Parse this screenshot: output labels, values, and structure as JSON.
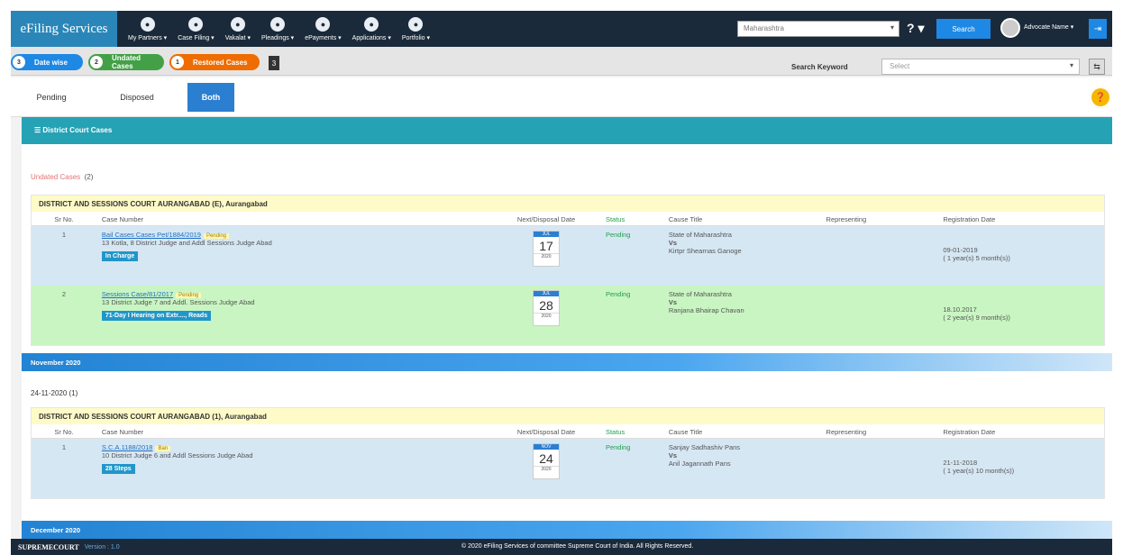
{
  "nav": {
    "brand": "eFiling Services",
    "items": [
      {
        "label": "My Partners ▾",
        "icon": "people-icon"
      },
      {
        "label": "Case Filing ▾",
        "icon": "edit-icon"
      },
      {
        "label": "Vakalat ▾",
        "icon": "document-icon"
      },
      {
        "label": "Pleadings ▾",
        "icon": "pleadings-icon"
      },
      {
        "label": "ePayments ▾",
        "icon": "rupee-icon"
      },
      {
        "label": "Applications ▾",
        "icon": "applications-icon"
      },
      {
        "label": "Portfolio ▾",
        "icon": "portfolio-icon"
      }
    ],
    "state_select": "Maharashtra",
    "help_label": "? ▾",
    "search_label": "Search",
    "user_name": "Advocate Name ▾"
  },
  "pills": [
    {
      "label": "Date wise",
      "count": "3",
      "color": "#1e88e5"
    },
    {
      "label": "Undated Cases",
      "count": "2",
      "color": "#43a047"
    },
    {
      "label": "Restored Cases",
      "count": "1",
      "color": "#ef6c00"
    }
  ],
  "square_label": "3",
  "search_keyword": {
    "label": "Search Keyword",
    "placeholder": "Select"
  },
  "tabs": [
    {
      "label": "Pending",
      "active": false
    },
    {
      "label": "Disposed",
      "active": false
    },
    {
      "label": "Both",
      "active": true
    }
  ],
  "section_title": "☰ District Court Cases",
  "undated": {
    "label": "Undated Cases",
    "count": "(2)"
  },
  "columns": [
    "Sr No.",
    "Case Number",
    "Next/Disposal Date",
    "Status",
    "Cause Title",
    "Representing",
    "Registration Date"
  ],
  "court1": {
    "name": "DISTRICT AND SESSIONS COURT AURANGABAD (E), Aurangabad",
    "rows": [
      {
        "sr": "1",
        "case": "Bail Cases Cases Pet/1884/2019",
        "tag": "Pending",
        "court_desc": "13 Kotla, 8 District Judge and Addl Sessions Judge Abad",
        "badge": "In Charge",
        "cal_month": "JUL",
        "cal_day": "17",
        "cal_year": "2020",
        "status": "Pending",
        "title1": "State of Maharashtra",
        "vs": "Vs",
        "title2": "Kirtpr Shearnas Ganoge",
        "representing": "",
        "reg_date": "09-01-2019",
        "reg_duration": "( 1 year(s) 5 month(s))"
      },
      {
        "sr": "2",
        "case": "Sessions Case/81/2017",
        "tag": "Pending",
        "court_desc": "13 District Judge 7 and Addl. Sessions Judge Abad",
        "badge": "71-Day I Hearing on Extr...., Reads",
        "cal_month": "JUL",
        "cal_day": "28",
        "cal_year": "2020",
        "status": "Pending",
        "title1": "State of Maharashtra",
        "vs": "Vs",
        "title2": "Ranjana Bhairap Chavan",
        "representing": "",
        "reg_date": "18.10.2017",
        "reg_duration": "( 2 year(s) 9 month(s))"
      }
    ]
  },
  "month1": "November 2020",
  "date_group": "24-11-2020 (1)",
  "court2": {
    "name": "DISTRICT AND SESSIONS COURT AURANGABAD (1), Aurangabad",
    "rows": [
      {
        "sr": "1",
        "case": "S.C.A.1188/2018",
        "tag": "Ban",
        "court_desc": "10 District Judge 6 and Addl Sessions Judge Abad",
        "badge": "28 Steps",
        "cal_month": "NOV",
        "cal_day": "24",
        "cal_year": "2020",
        "status": "Pending",
        "title1": "Sanjay Sadhashiv Pans",
        "vs": "Vs",
        "title2": "Anil Jagannath Pans",
        "representing": "",
        "reg_date": "21-11-2018",
        "reg_duration": "( 1 year(s) 10 month(s))"
      }
    ]
  },
  "month2": "December 2020",
  "footer": {
    "logo": "SUPREMECOURT",
    "version": "Version : 1.0",
    "copyright": "© 2020 eFiling Services of committee Supreme Court of India. All Rights Reserved."
  }
}
